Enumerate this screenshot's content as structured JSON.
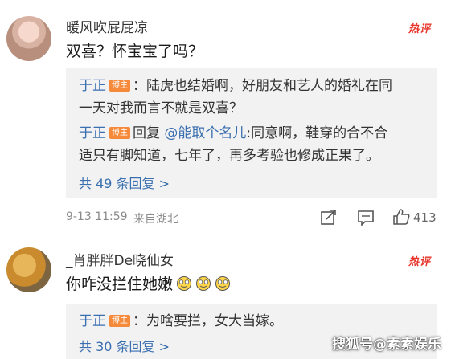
{
  "comments": [
    {
      "username": "暖风吹屁屁凉",
      "hot_label": "热评",
      "content": "双喜？怀宝宝了吗？",
      "replies": [
        {
          "author": "于正",
          "badge": "博主",
          "text1": "：陆虎也结婚啊，好朋友和艺人的婚礼在同",
          "text2": "一天对我而言不就是双喜？"
        },
        {
          "author": "于正",
          "badge": "博主",
          "reply_word": "回复",
          "mention": "@能取个名儿",
          "text1": ":同意啊，鞋穿的合不合",
          "text2": "适只有脚知道，七年了，再多考验也修成正果了。"
        }
      ],
      "more_replies": "共 49 条回复 >",
      "time": "9-13 11:59",
      "location": "来自湖北",
      "like_count": "413"
    },
    {
      "username": "_肖胖胖De晓仙女",
      "hot_label": "热评",
      "content": "你咋没拦住她嫩",
      "replies": [
        {
          "author": "于正",
          "badge": "博主",
          "text1": "：为啥要拦，女大当嫁。"
        }
      ],
      "more_replies": "共 30 条回复 >"
    }
  ],
  "watermark": "搜狐号@素素娱乐",
  "icons": {
    "share": "share-icon",
    "comment": "comment-icon",
    "like": "thumbs-up-icon",
    "emoji": "laughing-tears-emoji"
  },
  "colors": {
    "link_blue": "#3a6fb0",
    "hot_red": "#e8352b",
    "badge_orange": "#f48a3a",
    "reply_bg": "#f2f2f2"
  }
}
